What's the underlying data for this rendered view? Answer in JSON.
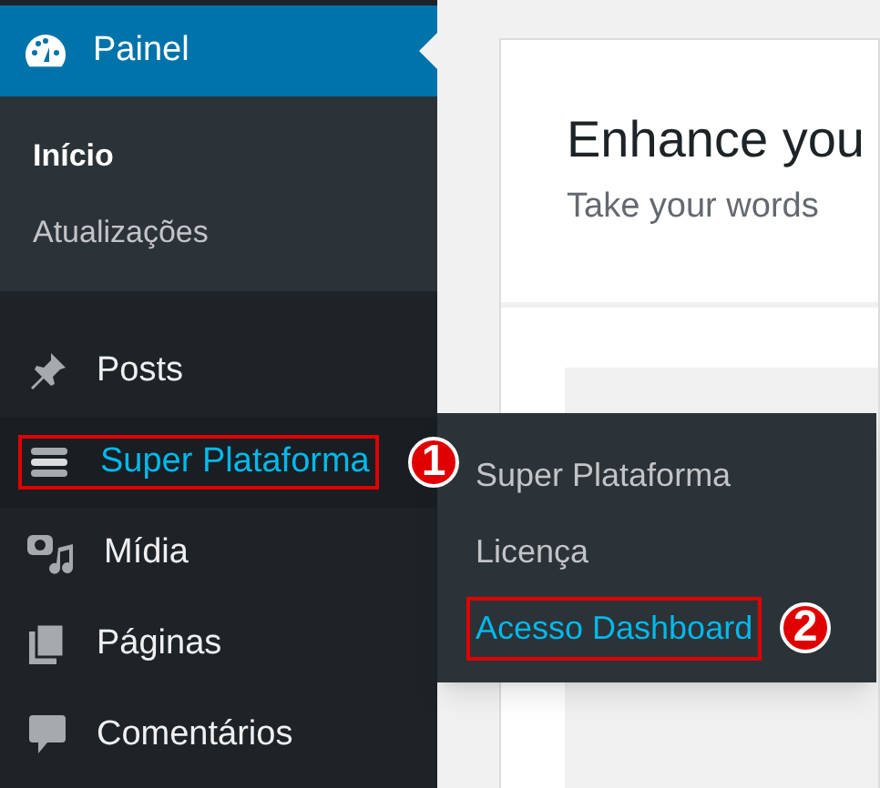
{
  "sidebar": {
    "current": {
      "label": "Painel",
      "selected": true
    },
    "submenu": [
      {
        "label": "Início",
        "selected": true
      },
      {
        "label": "Atualizações",
        "selected": false
      }
    ],
    "items": [
      {
        "label": "Posts",
        "highlighted": false
      },
      {
        "label": "Super Plataforma",
        "highlighted": true,
        "annotation": "1"
      },
      {
        "label": "Mídia",
        "highlighted": false
      },
      {
        "label": "Páginas",
        "highlighted": false
      },
      {
        "label": "Comentários",
        "highlighted": false
      }
    ]
  },
  "flyout": {
    "items": [
      {
        "label": "Super Plataforma",
        "highlighted": false
      },
      {
        "label": "Licença",
        "highlighted": false
      },
      {
        "label": "Acesso Dashboard",
        "highlighted": true,
        "annotation": "2"
      }
    ]
  },
  "content": {
    "heading": "Enhance you",
    "subtitle": "Take your words"
  }
}
